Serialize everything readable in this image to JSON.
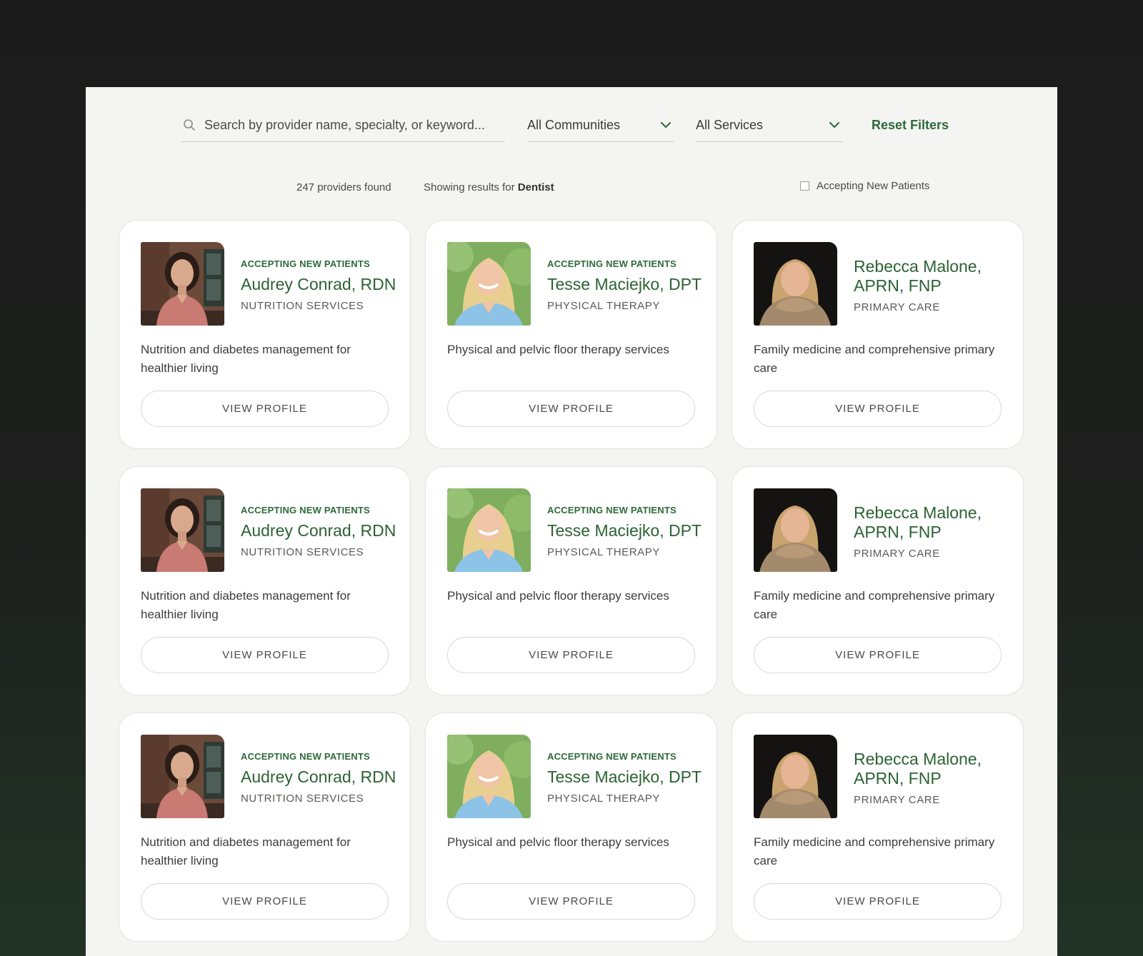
{
  "search": {
    "placeholder": "Search by provider name, specialty, or keyword..."
  },
  "filters": {
    "communities_label": "All Communities",
    "services_label": "All Services",
    "reset_label": "Reset Filters",
    "accepting_label": "Accepting New Patients",
    "accepting_checked": false
  },
  "results": {
    "count_text": "247 providers found",
    "showing_prefix": "Showing results for",
    "showing_term": "Dentist"
  },
  "colors": {
    "brand_green": "#2c6234",
    "panel_bg": "#f4f4f3",
    "page_bg": "#1b1b1b"
  },
  "cards": [
    {
      "badge": "ACCEPTING NEW PATIENTS",
      "name": "Audrey Conrad, RDN",
      "specialty": "NUTRITION SERVICES",
      "description": "Nutrition and diabetes management for healthier living",
      "button": "VIEW PROFILE",
      "photo": "audrey"
    },
    {
      "badge": "ACCEPTING NEW PATIENTS",
      "name": "Tesse Maciejko, DPT",
      "specialty": "PHYSICAL THERAPY",
      "description": "Physical and pelvic floor therapy services",
      "button": "VIEW PROFILE",
      "photo": "tesse"
    },
    {
      "badge": "",
      "name": "Rebecca Malone, APRN, FNP",
      "specialty": "PRIMARY CARE",
      "description": "Family medicine and comprehensive primary care",
      "button": "VIEW PROFILE",
      "photo": "rebecca"
    },
    {
      "badge": "ACCEPTING NEW PATIENTS",
      "name": "Audrey Conrad, RDN",
      "specialty": "NUTRITION SERVICES",
      "description": "Nutrition and diabetes management for healthier living",
      "button": "VIEW PROFILE",
      "photo": "audrey"
    },
    {
      "badge": "ACCEPTING NEW PATIENTS",
      "name": "Tesse Maciejko, DPT",
      "specialty": "PHYSICAL THERAPY",
      "description": "Physical and pelvic floor therapy services",
      "button": "VIEW PROFILE",
      "photo": "tesse"
    },
    {
      "badge": "",
      "name": "Rebecca Malone, APRN, FNP",
      "specialty": "PRIMARY CARE",
      "description": "Family medicine and comprehensive primary care",
      "button": "VIEW PROFILE",
      "photo": "rebecca"
    },
    {
      "badge": "ACCEPTING NEW PATIENTS",
      "name": "Audrey Conrad, RDN",
      "specialty": "NUTRITION SERVICES",
      "description": "Nutrition and diabetes management for healthier living",
      "button": "VIEW PROFILE",
      "photo": "audrey"
    },
    {
      "badge": "ACCEPTING NEW PATIENTS",
      "name": "Tesse Maciejko, DPT",
      "specialty": "PHYSICAL THERAPY",
      "description": "Physical and pelvic floor therapy services",
      "button": "VIEW PROFILE",
      "photo": "tesse"
    },
    {
      "badge": "",
      "name": "Rebecca Malone, APRN, FNP",
      "specialty": "PRIMARY CARE",
      "description": "Family medicine and comprehensive primary care",
      "button": "VIEW PROFILE",
      "photo": "rebecca"
    }
  ]
}
